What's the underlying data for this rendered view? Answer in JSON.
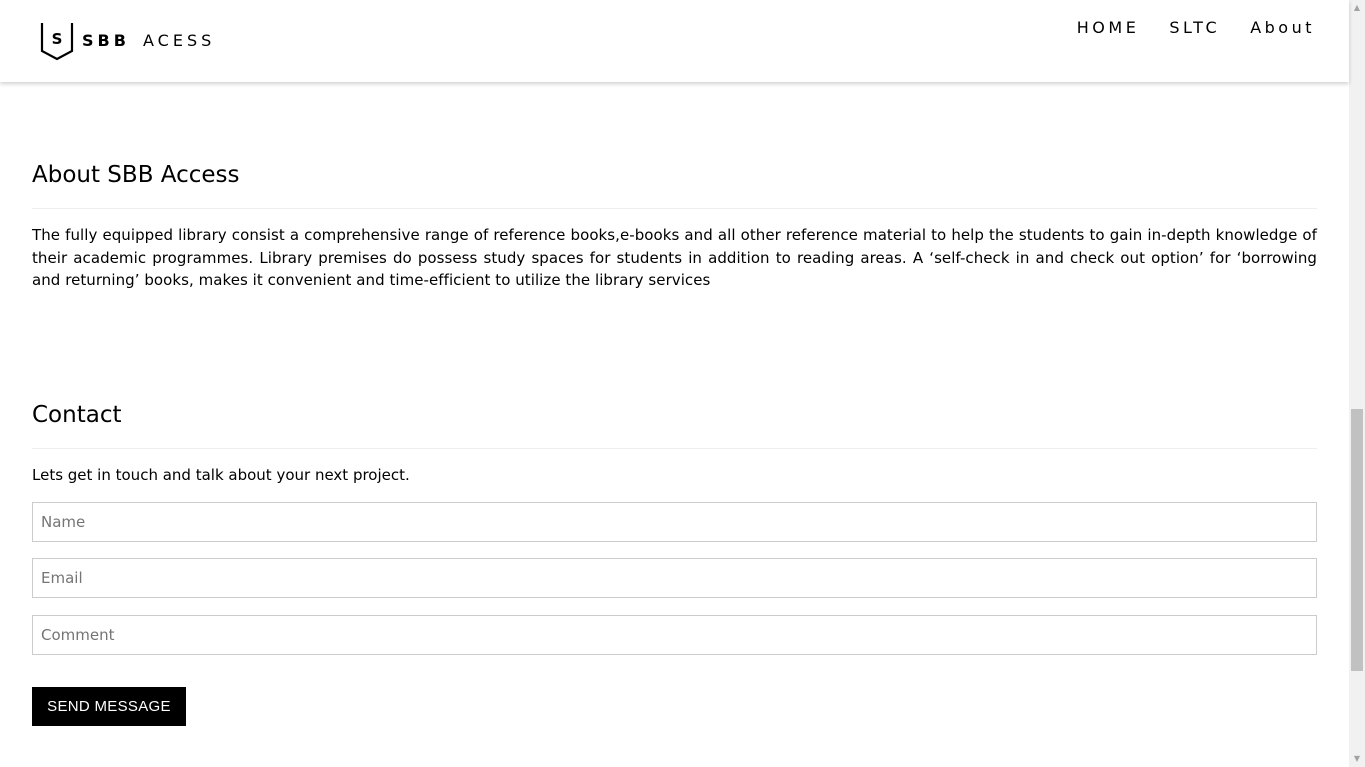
{
  "header": {
    "logo_letter": "S",
    "logo_bold": "SBB",
    "logo_light": "ACESS",
    "nav": [
      "HOME",
      "SLTC",
      "About"
    ]
  },
  "about": {
    "title": "About SBB Access",
    "text": "The fully equipped library consist a comprehensive range of reference books,e-books and all other reference material to help the students to gain in-depth knowledge of their academic programmes. Library premises do possess study spaces for students in addition to reading areas. A ‘self-check in and check out option’ for ‘borrowing and returning’ books, makes it convenient and time-efficient to utilize the library services"
  },
  "contact": {
    "title": "Contact",
    "intro": "Lets get in touch and talk about your next project.",
    "name_placeholder": "Name",
    "email_placeholder": "Email",
    "comment_placeholder": "Comment",
    "name_value": "",
    "email_value": "",
    "comment_value": "",
    "send_label": "SEND MESSAGE"
  },
  "scrollbar": {
    "up_icon": "chevron-up-icon",
    "down_icon": "chevron-down-icon"
  },
  "colors": {
    "button_bg": "#000000",
    "button_text": "#ffffff",
    "border": "#cccccc"
  }
}
